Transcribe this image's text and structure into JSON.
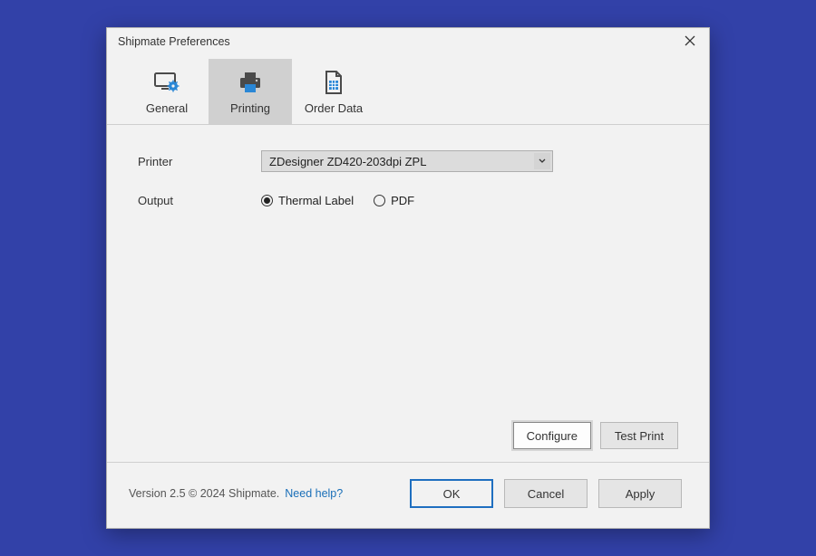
{
  "window": {
    "title": "Shipmate Preferences"
  },
  "tabs": {
    "general": "General",
    "printing": "Printing",
    "order_data": "Order Data",
    "active": "printing"
  },
  "form": {
    "printer_label": "Printer",
    "printer_value": "ZDesigner ZD420-203dpi ZPL",
    "output_label": "Output",
    "output_options": {
      "thermal": "Thermal Label",
      "pdf": "PDF"
    },
    "output_selected": "thermal"
  },
  "actions": {
    "configure": "Configure",
    "test_print": "Test Print"
  },
  "footer": {
    "version_text": "Version 2.5 © 2024 Shipmate.",
    "help_link": "Need help?",
    "ok": "OK",
    "cancel": "Cancel",
    "apply": "Apply"
  }
}
